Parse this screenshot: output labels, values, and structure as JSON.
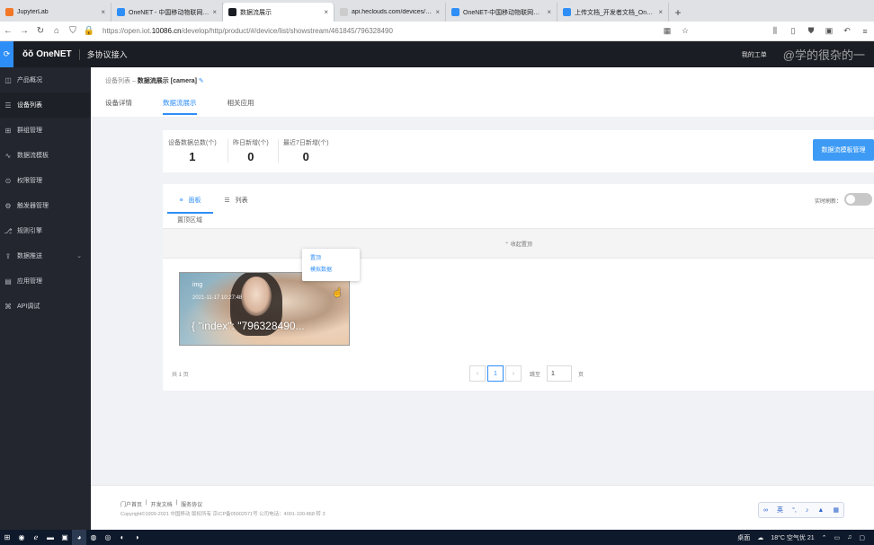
{
  "browser": {
    "tabs": [
      {
        "title": "JupyterLab",
        "fav_color": "#f37726",
        "active": false
      },
      {
        "title": "OneNET - 中国移动物联网开放",
        "fav_color": "#2e8ef7",
        "active": false
      },
      {
        "title": "数据流展示",
        "fav_color": "#1a1d23",
        "active": true
      },
      {
        "title": "api.heclouds.com/devices/7963",
        "fav_color": "#cccccc",
        "active": false
      },
      {
        "title": "OneNET-中国移动物联网开放",
        "fav_color": "#2e8ef7",
        "active": false
      },
      {
        "title": "上传文档_开发者文档_OneNET",
        "fav_color": "#2e8ef7",
        "active": false
      }
    ],
    "url_prefix": "https://open.iot.",
    "url_domain": "10086.cn",
    "url_path": "/develop/http/product/#/device/list/showstream/461845/796328490"
  },
  "header": {
    "brand": "OneNET",
    "sub": "多协议接入",
    "my_ticket": "我的工单",
    "watermark": "@学的很杂的一"
  },
  "sidebar": {
    "items": [
      {
        "label": "产品概况",
        "icon": "◫"
      },
      {
        "label": "设备列表",
        "icon": "☰"
      },
      {
        "label": "群组管理",
        "icon": "⊞"
      },
      {
        "label": "数据流模板",
        "icon": "∿"
      },
      {
        "label": "权限管理",
        "icon": "⊙"
      },
      {
        "label": "触发器管理",
        "icon": "⚙"
      },
      {
        "label": "规则引擎",
        "icon": "⎇"
      },
      {
        "label": "数据推送",
        "icon": "⇪"
      },
      {
        "label": "应用管理",
        "icon": "▤"
      },
      {
        "label": "API调试",
        "icon": "⌘"
      }
    ]
  },
  "page": {
    "breadcrumb_parent": "设备列表",
    "breadcrumb_sep": " – ",
    "breadcrumb_current": "数据流展示 [camera]",
    "tabs": [
      "设备详情",
      "数据流展示",
      "相关应用"
    ]
  },
  "stats": {
    "total_label": "设备数据总数(个)",
    "total_value": "1",
    "yesterday_label": "昨日新增(个)",
    "yesterday_value": "0",
    "last7_label": "最近7日新增(个)",
    "last7_value": "0",
    "template_button": "数据流模板管理"
  },
  "view": {
    "tab_panel": "面板",
    "tab_list": "列表",
    "realtime_label": "实时刷新：",
    "realtime_on": false,
    "pinned_label": "置顶区域",
    "collapse_label": "⌃ 收起置顶"
  },
  "stream_card": {
    "name": "img",
    "time": "2021-11-17 10:27:48",
    "value": "{ \"index\": \"796328490..."
  },
  "popup_menu": {
    "items": [
      "置顶",
      "模拟数据"
    ]
  },
  "pager": {
    "total": "共 1 页",
    "prev": "‹",
    "current": "1",
    "next": "›",
    "goto_label": "跳至",
    "goto_value": "1",
    "page_unit": "页"
  },
  "footer": {
    "links": [
      "门户首页",
      "|",
      "开发文档",
      "|",
      "服务协议"
    ],
    "copyright": "Copyright©1999-2021 中国移动 版权所有 京ICP备05002571号 公司电话：4001-100-868 转 3",
    "ime": [
      "∞",
      "英",
      "°,",
      "♪",
      "▲",
      "▦"
    ]
  },
  "taskbar": {
    "weather": "18°C 空气优 21",
    "desktop": "桌面"
  }
}
